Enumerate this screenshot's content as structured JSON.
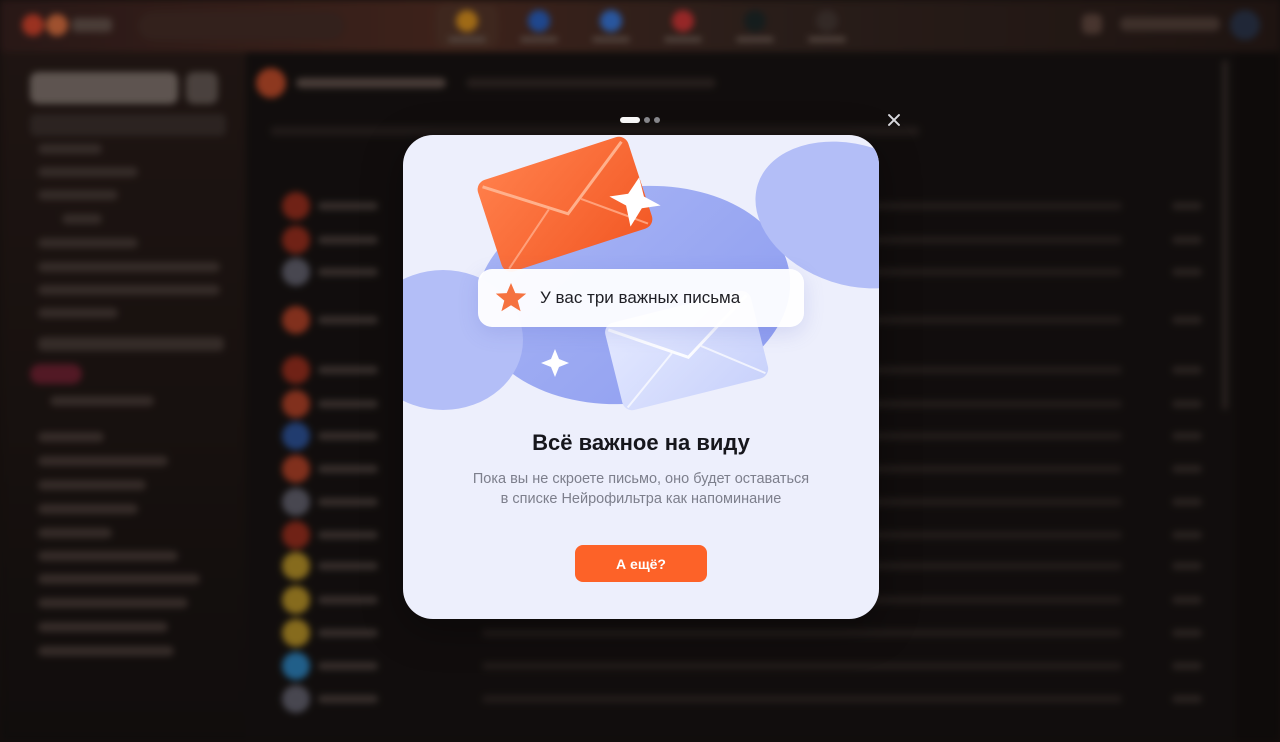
{
  "modal": {
    "toast_text": "У вас три важных письма",
    "title": "Всё важное на виду",
    "description_line1": "Пока вы не скроете письмо, оно будет оставаться",
    "description_line2": "в списке Нейрофильтра как напоминание",
    "button_label": "А ещё?",
    "pager": {
      "total": 3,
      "active": 1
    }
  },
  "colors": {
    "accent": "#fd6228",
    "modal_bg": "#edeffc",
    "title": "#16161c",
    "description": "#7d7f8c"
  },
  "icons": [
    "close-icon",
    "star-icon",
    "envelope-icon",
    "sparkle-icon"
  ]
}
